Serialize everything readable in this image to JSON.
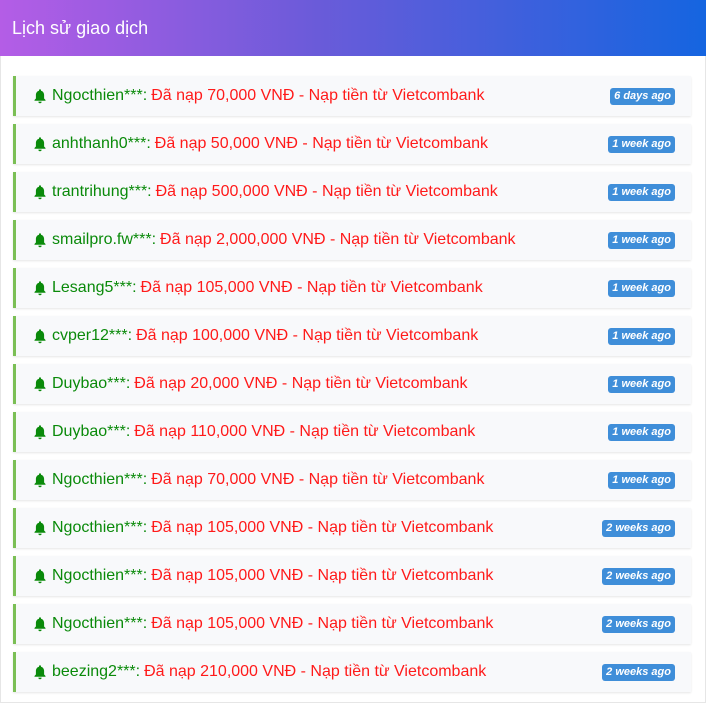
{
  "header": {
    "title": "Lịch sử giao dịch"
  },
  "colors": {
    "username": "#0a8a0a",
    "message": "#ff1a1a",
    "badge": "#3f8ed9",
    "accent_border": "#7bbf55"
  },
  "transactions": [
    {
      "user": "Ngocthien***",
      "message": "Đã nạp 70,000 VNĐ - Nạp tiền từ Vietcombank",
      "time": "6 days ago"
    },
    {
      "user": "anhthanh0***",
      "message": "Đã nạp 50,000 VNĐ - Nạp tiền từ Vietcombank",
      "time": "1 week ago"
    },
    {
      "user": "trantrihung***",
      "message": "Đã nạp 500,000 VNĐ - Nạp tiền từ Vietcombank",
      "time": "1 week ago"
    },
    {
      "user": "smailpro.fw***",
      "message": "Đã nạp 2,000,000 VNĐ - Nạp tiền từ Vietcombank",
      "time": "1 week ago"
    },
    {
      "user": "Lesang5***",
      "message": "Đã nạp 105,000 VNĐ - Nạp tiền từ Vietcombank",
      "time": "1 week ago"
    },
    {
      "user": "cvper12***",
      "message": "Đã nạp 100,000 VNĐ - Nạp tiền từ Vietcombank",
      "time": "1 week ago"
    },
    {
      "user": "Duybao***",
      "message": "Đã nạp 20,000 VNĐ - Nạp tiền từ Vietcombank",
      "time": "1 week ago"
    },
    {
      "user": "Duybao***",
      "message": "Đã nạp 110,000 VNĐ - Nạp tiền từ Vietcombank",
      "time": "1 week ago"
    },
    {
      "user": "Ngocthien***",
      "message": "Đã nạp 70,000 VNĐ - Nạp tiền từ Vietcombank",
      "time": "1 week ago"
    },
    {
      "user": "Ngocthien***",
      "message": "Đã nạp 105,000 VNĐ - Nạp tiền từ Vietcombank",
      "time": "2 weeks ago"
    },
    {
      "user": "Ngocthien***",
      "message": "Đã nạp 105,000 VNĐ - Nạp tiền từ Vietcombank",
      "time": "2 weeks ago"
    },
    {
      "user": "Ngocthien***",
      "message": "Đã nạp 105,000 VNĐ - Nạp tiền từ Vietcombank",
      "time": "2 weeks ago"
    },
    {
      "user": "beezing2***",
      "message": "Đã nạp 210,000 VNĐ - Nạp tiền từ Vietcombank",
      "time": "2 weeks ago"
    }
  ],
  "icons": {
    "row_icon": "bell-icon"
  }
}
